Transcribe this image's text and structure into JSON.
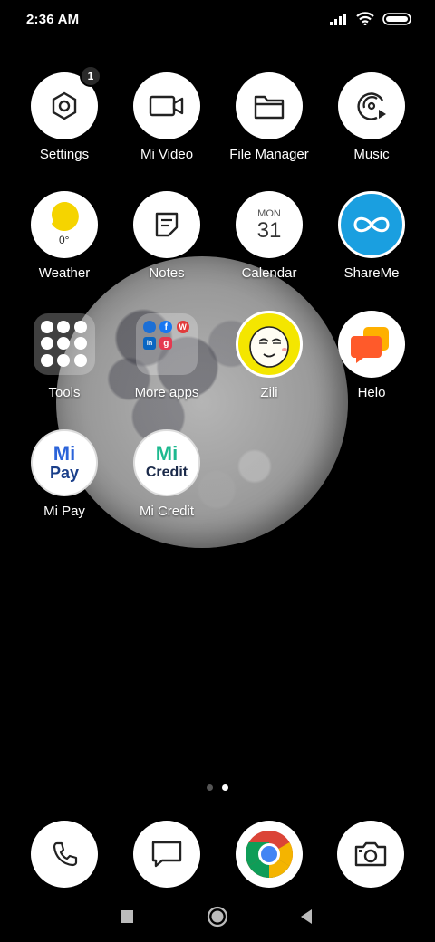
{
  "status_bar": {
    "time": "2:36 AM",
    "icons": [
      "signal-icon",
      "wifi-icon",
      "battery-icon"
    ]
  },
  "apps": {
    "settings": {
      "label": "Settings",
      "badge": "1",
      "icon": "settings-hexagon-icon"
    },
    "mi_video": {
      "label": "Mi Video",
      "icon": "video-camera-icon"
    },
    "file_manager": {
      "label": "File Manager",
      "icon": "folder-icon"
    },
    "music": {
      "label": "Music",
      "icon": "music-disc-icon"
    },
    "weather": {
      "label": "Weather",
      "temp": "0°",
      "icon": "weather-sun-icon"
    },
    "notes": {
      "label": "Notes",
      "icon": "note-edit-icon"
    },
    "calendar": {
      "label": "Calendar",
      "month": "MON",
      "day": "31",
      "icon": "calendar-icon"
    },
    "shareme": {
      "label": "ShareMe",
      "icon": "infinity-icon"
    },
    "tools": {
      "label": "Tools",
      "icon": "folder-tools-icon"
    },
    "more_apps": {
      "label": "More apps",
      "icon": "folder-apps-icon"
    },
    "zili": {
      "label": "Zili",
      "icon": "zili-face-icon"
    },
    "helo": {
      "label": "Helo",
      "icon": "helo-chat-icon"
    },
    "mi_pay": {
      "label": "Mi Pay",
      "logo_top": "Mi",
      "logo_bottom": "Pay",
      "icon": "mi-pay-icon"
    },
    "mi_credit": {
      "label": "Mi Credit",
      "logo_top": "Mi",
      "logo_bottom": "Credit",
      "icon": "mi-credit-icon"
    }
  },
  "more_apps_mini": {
    "w_text": "W",
    "g_text": "g",
    "f_text": "f",
    "in_text": "in"
  },
  "pages": {
    "count": 2,
    "active_index": 1
  },
  "dock": [
    "phone-icon",
    "messages-icon",
    "chrome-icon",
    "camera-icon"
  ],
  "nav": [
    "recents-button",
    "home-button",
    "back-button"
  ],
  "colors": {
    "background": "#000000",
    "shareme": "#1a9fe0",
    "weather_sun": "#f5d400",
    "zili": "#f4e600",
    "helo": "#ff5a2a",
    "mi_pay": "#2b63d9",
    "mi_credit": "#1db98f"
  }
}
